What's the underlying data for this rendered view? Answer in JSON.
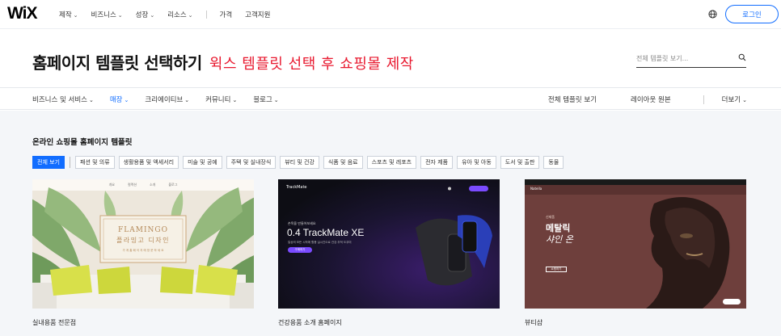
{
  "nav": {
    "logo": "WiX",
    "items": [
      {
        "label": "제작",
        "has_menu": true
      },
      {
        "label": "비즈니스",
        "has_menu": true
      },
      {
        "label": "성장",
        "has_menu": true
      },
      {
        "label": "리소스",
        "has_menu": true
      },
      {
        "label": "가격",
        "has_menu": false
      },
      {
        "label": "고객지원",
        "has_menu": false
      }
    ],
    "login_label": "로그인",
    "globe_icon": "globe-icon",
    "accent_color": "#116dff"
  },
  "header": {
    "title": "홈페이지 템플릿 선택하기",
    "title_annotation": "윅스 템플릿 선택 후 쇼핑몰 제작",
    "annotation_color": "#e8182e",
    "search_placeholder": "전체 템플릿 보기..."
  },
  "categories": {
    "left": [
      {
        "label": "비즈니스 및 서비스",
        "active": false
      },
      {
        "label": "매장",
        "active": true
      },
      {
        "label": "크리에이티브",
        "active": false
      },
      {
        "label": "커뮤니티",
        "active": false
      },
      {
        "label": "블로그",
        "active": false
      }
    ],
    "right": {
      "all_templates": "전체 템플릿 보기",
      "blank": "레이아웃 원본",
      "more": "더보기"
    }
  },
  "section": {
    "title": "온라인 쇼핑몰 홈페이지 템플릿",
    "filters": [
      "전체 보기",
      "패션 및 의류",
      "생활용품 및 액세서리",
      "미술 및 공예",
      "주택 및 실내장식",
      "뷰티 및 건강",
      "식품 및 음료",
      "스포츠 및 레포츠",
      "전자 제품",
      "유아 및 아동",
      "도서 및 출판",
      "동물"
    ],
    "active_filter": "전체 보기"
  },
  "templates": [
    {
      "name": "실내용품 전문점",
      "preview": {
        "nav": [
          "개요",
          "컬렉션",
          "소개",
          "블로그"
        ],
        "title": "FLAMINGO",
        "subtitle": "플라밍고 디자인",
        "tagline": "가 게 홈 페 이 지 에 방 문 하 세 요"
      }
    },
    {
      "name": "건강용품 소개 홈페이지",
      "preview": {
        "brand": "TrackMate",
        "eyebrow": "손목을 만들어보세요",
        "title": "0.4 TrackMate XE",
        "body": "일상의 모든 시작에 활용 실시간으로 건강 추적 도우미",
        "button": "구매하기"
      }
    },
    {
      "name": "뷰티샵",
      "preview": {
        "brand": "Natella",
        "eyebrow": "신제품",
        "title": "메탈릭",
        "title2": "샤인 온",
        "button": "쇼핑하기"
      }
    }
  ]
}
